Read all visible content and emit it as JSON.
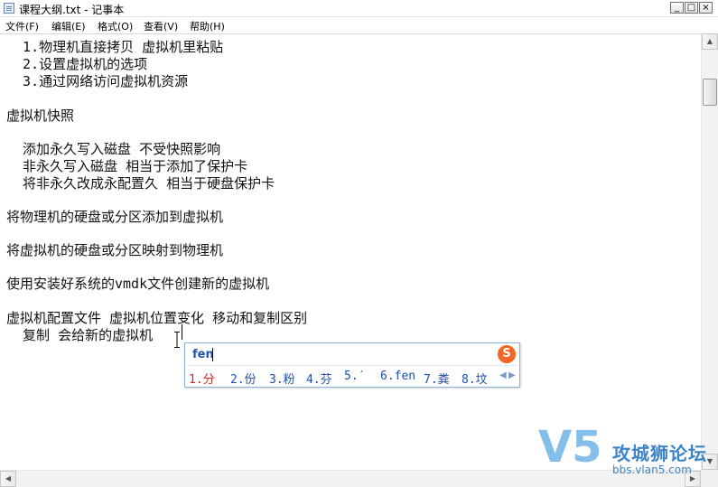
{
  "window": {
    "title": "课程大纲.txt - 记事本",
    "minimize": "_",
    "maximize": "□",
    "close": "×"
  },
  "menu": [
    {
      "label": "文件(F)"
    },
    {
      "label": "编辑(E)"
    },
    {
      "label": "格式(O)"
    },
    {
      "label": "查看(V)"
    },
    {
      "label": "帮助(H)"
    }
  ],
  "document": {
    "lines": [
      "  1.物理机直接拷贝 虚拟机里粘贴",
      "  2.设置虚拟机的选项",
      "  3.通过网络访问虚拟机资源",
      "",
      "虚拟机快照",
      "",
      "  添加永久写入磁盘 不受快照影响",
      "  非永久写入磁盘 相当于添加了保护卡",
      "  将非永久改成永配置久 相当于硬盘保护卡",
      "",
      "将物理机的硬盘或分区添加到虚拟机",
      "",
      "将虚拟机的硬盘或分区映射到物理机",
      "",
      "使用安装好系统的vmdk文件创建新的虚拟机",
      "",
      "虚拟机配置文件 虚拟机位置变化 移动和复制区别",
      "  复制 会给新的虚拟机"
    ]
  },
  "ime": {
    "input": "fen",
    "logo_icon": "sogou-icon",
    "logo_text": "S",
    "candidates": [
      "1.分",
      "2.份",
      "3.粉",
      "4.芬",
      "5.′",
      "6.fen",
      "7.粪",
      "8.坟"
    ],
    "prev": "◀",
    "next": "▶"
  },
  "scrollbars": {
    "up": "▲",
    "down": "▼",
    "left": "◀",
    "right": "▶"
  },
  "watermark": {
    "logo_text": "V5",
    "name": "攻城狮论坛",
    "url": "bbs.vlan5.com"
  }
}
